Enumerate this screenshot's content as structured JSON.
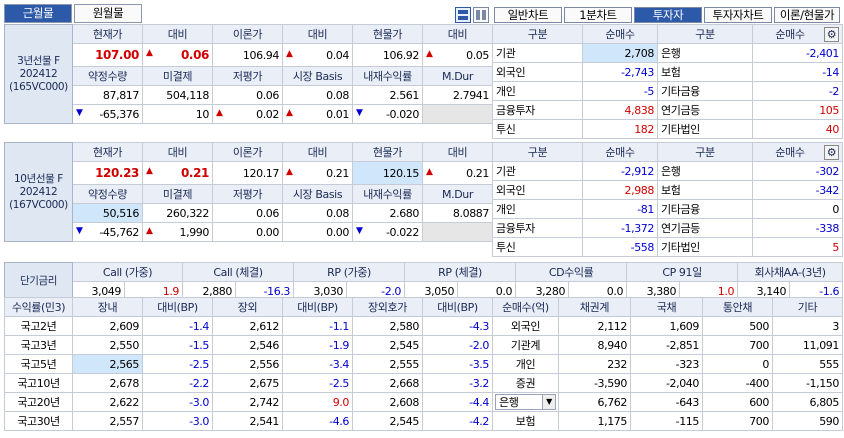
{
  "tabs": [
    {
      "label": "근월물"
    },
    {
      "label": "원월물"
    }
  ],
  "chart_buttons": [
    {
      "label": "일반차트"
    },
    {
      "label": "1분차트"
    },
    {
      "label": "투자자"
    },
    {
      "label": "투자자차트"
    },
    {
      "label": "이론/현물가"
    }
  ],
  "futures": [
    {
      "name": "3년선물 F 202412 (165VC000)",
      "h1": [
        "현재가",
        "대비",
        "이론가",
        "대비",
        "현물가",
        "대비"
      ],
      "r1": [
        "107.00",
        "0.06",
        "106.94",
        "0.04",
        "106.92",
        "0.05"
      ],
      "h2": [
        "약정수량",
        "미결제",
        "저평가",
        "시장 Basis",
        "내재수익률",
        "M.Dur"
      ],
      "r2": [
        "87,817",
        "504,118",
        "0.06",
        "0.08",
        "2.561",
        "2.7941"
      ],
      "r3": [
        "-65,376",
        "10",
        "0.02",
        "0.01",
        "-0.020",
        ""
      ]
    },
    {
      "name": "10년선물 F 202412 (167VC000)",
      "h1": [
        "현재가",
        "대비",
        "이론가",
        "대비",
        "현물가",
        "대비"
      ],
      "r1": [
        "120.23",
        "0.21",
        "120.17",
        "0.21",
        "120.15",
        "0.21"
      ],
      "h2": [
        "약정수량",
        "미결제",
        "저평가",
        "시장 Basis",
        "내재수익률",
        "M.Dur"
      ],
      "r2": [
        "50,516",
        "260,322",
        "0.06",
        "0.08",
        "2.680",
        "8.0887"
      ],
      "r3": [
        "-45,762",
        "1,990",
        "0.00",
        "0.00",
        "-0.022",
        ""
      ]
    }
  ],
  "investors": [
    {
      "headers": [
        "구분",
        "순매수",
        "구분",
        "순매수"
      ],
      "rows": [
        [
          "기관",
          "2,708",
          "은행",
          "-2,401"
        ],
        [
          "외국인",
          "-2,743",
          "보험",
          "-14"
        ],
        [
          "개인",
          "-5",
          "기타금융",
          "-2"
        ],
        [
          "금융투자",
          "4,838",
          "연기금등",
          "105"
        ],
        [
          "투신",
          "182",
          "기타법인",
          "40"
        ]
      ]
    },
    {
      "headers": [
        "구분",
        "순매수",
        "구분",
        "순매수"
      ],
      "rows": [
        [
          "기관",
          "-2,912",
          "은행",
          "-302"
        ],
        [
          "외국인",
          "2,988",
          "보험",
          "-342"
        ],
        [
          "개인",
          "-81",
          "기타금융",
          "0"
        ],
        [
          "금융투자",
          "-1,372",
          "연기금등",
          "-338"
        ],
        [
          "투신",
          "-558",
          "기타법인",
          "5"
        ]
      ]
    }
  ],
  "short_rate": {
    "label": "단기금리",
    "headers": [
      "Call (가중)",
      "Call (체결)",
      "RP (가중)",
      "RP (체결)",
      "CD수익률",
      "CP 91일",
      "회사채AA-(3년)"
    ],
    "values": [
      [
        "3,049",
        "1.9"
      ],
      [
        "2,880",
        "-16.3"
      ],
      [
        "3,030",
        "-2.0"
      ],
      [
        "3,050",
        "0.0"
      ],
      [
        "3,280",
        "0.0"
      ],
      [
        "3,380",
        "1.0"
      ],
      [
        "3,140",
        "-1.6"
      ]
    ]
  },
  "yield": {
    "headers": [
      "수익률(민3)",
      "장내",
      "대비(BP)",
      "장외",
      "대비(BP)",
      "장외호가",
      "대비(BP)"
    ],
    "rows": [
      [
        "국고2년",
        "2,609",
        "-1.4",
        "2,612",
        "-1.1",
        "2,580",
        "-4.3"
      ],
      [
        "국고3년",
        "2,550",
        "-1.5",
        "2,546",
        "-1.9",
        "2,545",
        "-2.0"
      ],
      [
        "국고5년",
        "2,565",
        "-2.5",
        "2,556",
        "-3.4",
        "2,555",
        "-3.5"
      ],
      [
        "국고10년",
        "2,678",
        "-2.2",
        "2,675",
        "-2.5",
        "2,668",
        "-3.2"
      ],
      [
        "국고20년",
        "2,622",
        "-3.0",
        "2,742",
        "9.0",
        "2,608",
        "-4.4"
      ],
      [
        "국고30년",
        "2,557",
        "-3.0",
        "2,541",
        "-4.6",
        "2,545",
        "-4.2"
      ]
    ]
  },
  "netbuy": {
    "headers": [
      "순매수(억)",
      "채권계",
      "국채",
      "통안채",
      "기타"
    ],
    "rows": [
      [
        "외국인",
        "2,112",
        "1,609",
        "500",
        "3"
      ],
      [
        "기관계",
        "8,940",
        "-2,851",
        "700",
        "11,091"
      ],
      [
        "개인",
        "232",
        "-323",
        "0",
        "555"
      ],
      [
        "증권",
        "-3,590",
        "-2,040",
        "-400",
        "-1,150"
      ],
      [
        "은행",
        "6,762",
        "-643",
        "600",
        "6,805"
      ],
      [
        "보험",
        "1,175",
        "-115",
        "700",
        "590"
      ]
    ]
  },
  "glyphs": {
    "up": "▲",
    "down": "▼",
    "dropdown": "▼",
    "gear": "⚙"
  }
}
